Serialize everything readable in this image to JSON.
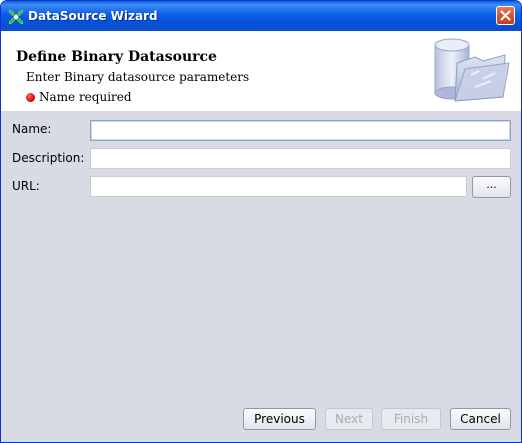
{
  "window": {
    "title": "DataSource Wizard"
  },
  "header": {
    "title": "Define Binary Datasource",
    "subtitle": "Enter Binary datasource parameters",
    "error": "Name required"
  },
  "form": {
    "name_label": "Name:",
    "name_value": "",
    "description_label": "Description:",
    "description_value": "",
    "url_label": "URL:",
    "url_value": "",
    "browse_label": "..."
  },
  "buttons": {
    "previous": "Previous",
    "next": "Next",
    "finish": "Finish",
    "cancel": "Cancel"
  },
  "icons": [
    "wizard-app-icon",
    "close-icon",
    "error-dot-icon",
    "datasource-folder-icon"
  ],
  "colors": {
    "titlebar": "#0553d9",
    "error": "#cc0000",
    "dialog_bg": "#d8dbe3"
  }
}
